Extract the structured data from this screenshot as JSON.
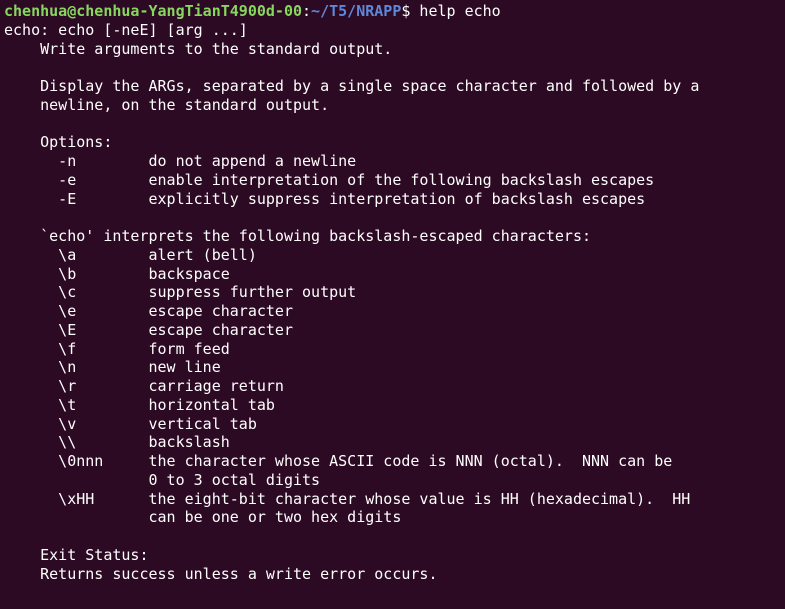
{
  "prompt": {
    "user_host": "chenhua@chenhua-YangTianT4900d-00",
    "colon": ":",
    "path": "~/T5/NRAPP",
    "dollar": "$ ",
    "command": "help echo"
  },
  "output": {
    "l01": "echo: echo [-neE] [arg ...]",
    "l02": "    Write arguments to the standard output.",
    "l03": "    ",
    "l04": "    Display the ARGs, separated by a single space character and followed by a",
    "l05": "    newline, on the standard output.",
    "l06": "    ",
    "l07": "    Options:",
    "l08": "      -n        do not append a newline",
    "l09": "      -e        enable interpretation of the following backslash escapes",
    "l10": "      -E        explicitly suppress interpretation of backslash escapes",
    "l11": "    ",
    "l12": "    `echo' interprets the following backslash-escaped characters:",
    "l13": "      \\a        alert (bell)",
    "l14": "      \\b        backspace",
    "l15": "      \\c        suppress further output",
    "l16": "      \\e        escape character",
    "l17": "      \\E        escape character",
    "l18": "      \\f        form feed",
    "l19": "      \\n        new line",
    "l20": "      \\r        carriage return",
    "l21": "      \\t        horizontal tab",
    "l22": "      \\v        vertical tab",
    "l23": "      \\\\        backslash",
    "l24": "      \\0nnn     the character whose ASCII code is NNN (octal).  NNN can be",
    "l25": "                0 to 3 octal digits",
    "l26": "      \\xHH      the eight-bit character whose value is HH (hexadecimal).  HH",
    "l27": "                can be one or two hex digits",
    "l28": "    ",
    "l29": "    Exit Status:",
    "l30": "    Returns success unless a write error occurs."
  }
}
